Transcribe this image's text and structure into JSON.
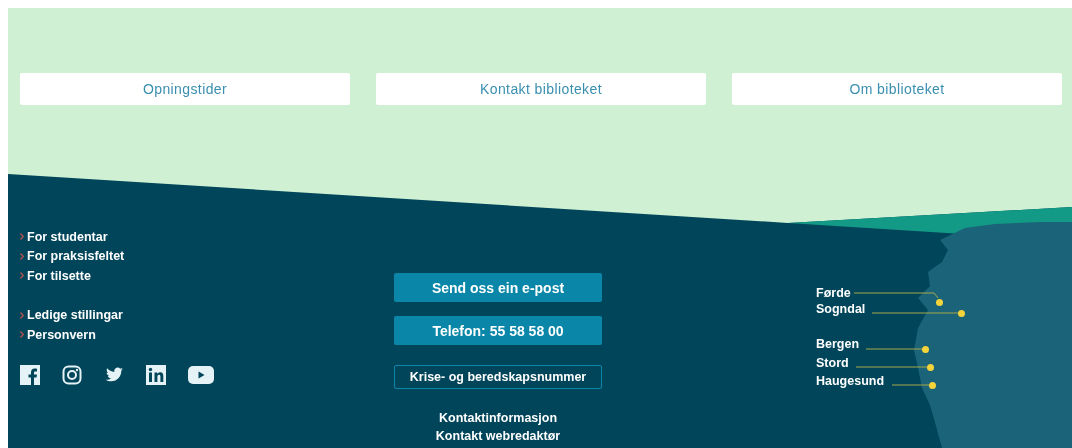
{
  "top_links": [
    {
      "label": "Opningstider"
    },
    {
      "label": "Kontakt biblioteket"
    },
    {
      "label": "Om biblioteket"
    }
  ],
  "footer": {
    "link_groups": [
      [
        "For studentar",
        "For praksisfeltet",
        "For tilsette"
      ],
      [
        "Ledige stillingar",
        "Personvern"
      ]
    ],
    "contact_buttons": [
      {
        "label": "Send oss ein e-post",
        "kind": "filled"
      },
      {
        "label": "Telefon: 55 58 58 00",
        "kind": "filled"
      },
      {
        "label": "Krise- og beredskapsnummer",
        "kind": "outline"
      }
    ],
    "contact_links": [
      "Kontaktinformasjon",
      "Kontakt webredaktør"
    ],
    "map_locations": [
      {
        "name": "Førde"
      },
      {
        "name": "Sogndal"
      },
      {
        "name": "Bergen"
      },
      {
        "name": "Stord"
      },
      {
        "name": "Haugesund"
      }
    ]
  }
}
